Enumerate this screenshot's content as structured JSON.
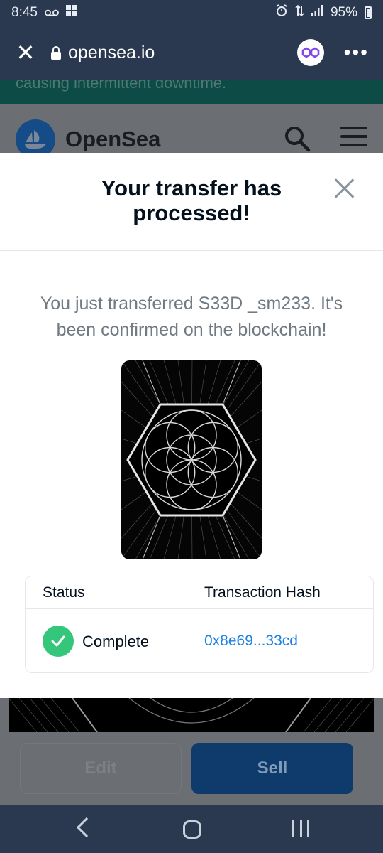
{
  "status_bar": {
    "time": "8:45",
    "battery": "95%"
  },
  "browser": {
    "url": "opensea.io"
  },
  "background_page": {
    "banner_text": "causing intermittent downtime.",
    "site_name": "OpenSea",
    "edit_label": "Edit",
    "sell_label": "Sell"
  },
  "modal": {
    "title": "Your transfer has processed!",
    "message": "You just transferred S33D _sm233. It's been confirmed on the blockchain!",
    "table": {
      "status_header": "Status",
      "hash_header": "Transaction Hash",
      "status_value": "Complete",
      "hash_value": "0x8e69...33cd"
    }
  },
  "colors": {
    "accent": "#2081e2",
    "success": "#34c77b",
    "system_bar": "#2a3950"
  }
}
